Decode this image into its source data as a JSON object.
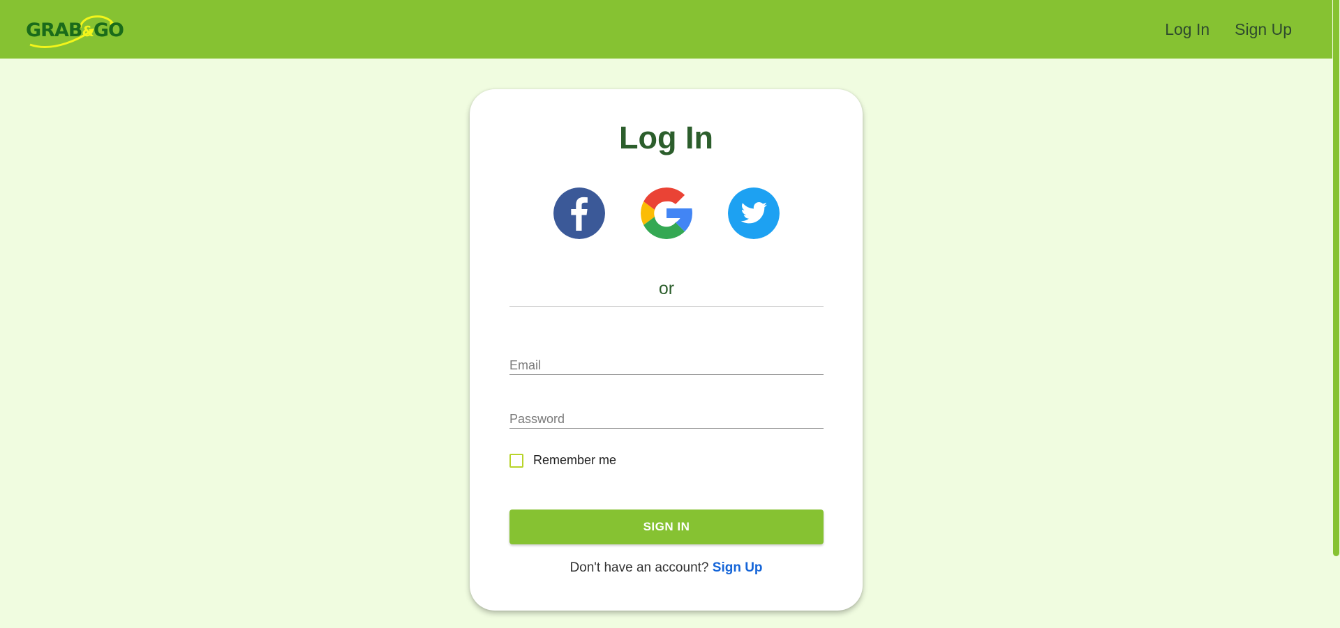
{
  "logo": {
    "text_left": "GRAB",
    "text_amp": "&",
    "text_right": "GO"
  },
  "nav": {
    "login_label": "Log In",
    "signup_label": "Sign Up"
  },
  "card": {
    "title": "Log In",
    "socials": [
      {
        "icon": "facebook-icon",
        "color": "#3b5998"
      },
      {
        "icon": "google-icon",
        "colors": [
          "#ea4335",
          "#fbbc05",
          "#34a853",
          "#4285f4"
        ]
      },
      {
        "icon": "twitter-icon",
        "color": "#1da1f2"
      }
    ],
    "divider_text": "or",
    "email": {
      "placeholder": "Email",
      "value": ""
    },
    "password": {
      "placeholder": "Password",
      "value": ""
    },
    "remember_label": "Remember me",
    "remember_checked": false,
    "signin_label": "SIGN IN",
    "footer_prompt": "Don't have an account?",
    "footer_link": "Sign Up"
  },
  "colors": {
    "brand_green": "#86c232",
    "page_bg": "#f0fce0",
    "title_green": "#2c5e2c",
    "link_blue": "#1565d8"
  }
}
